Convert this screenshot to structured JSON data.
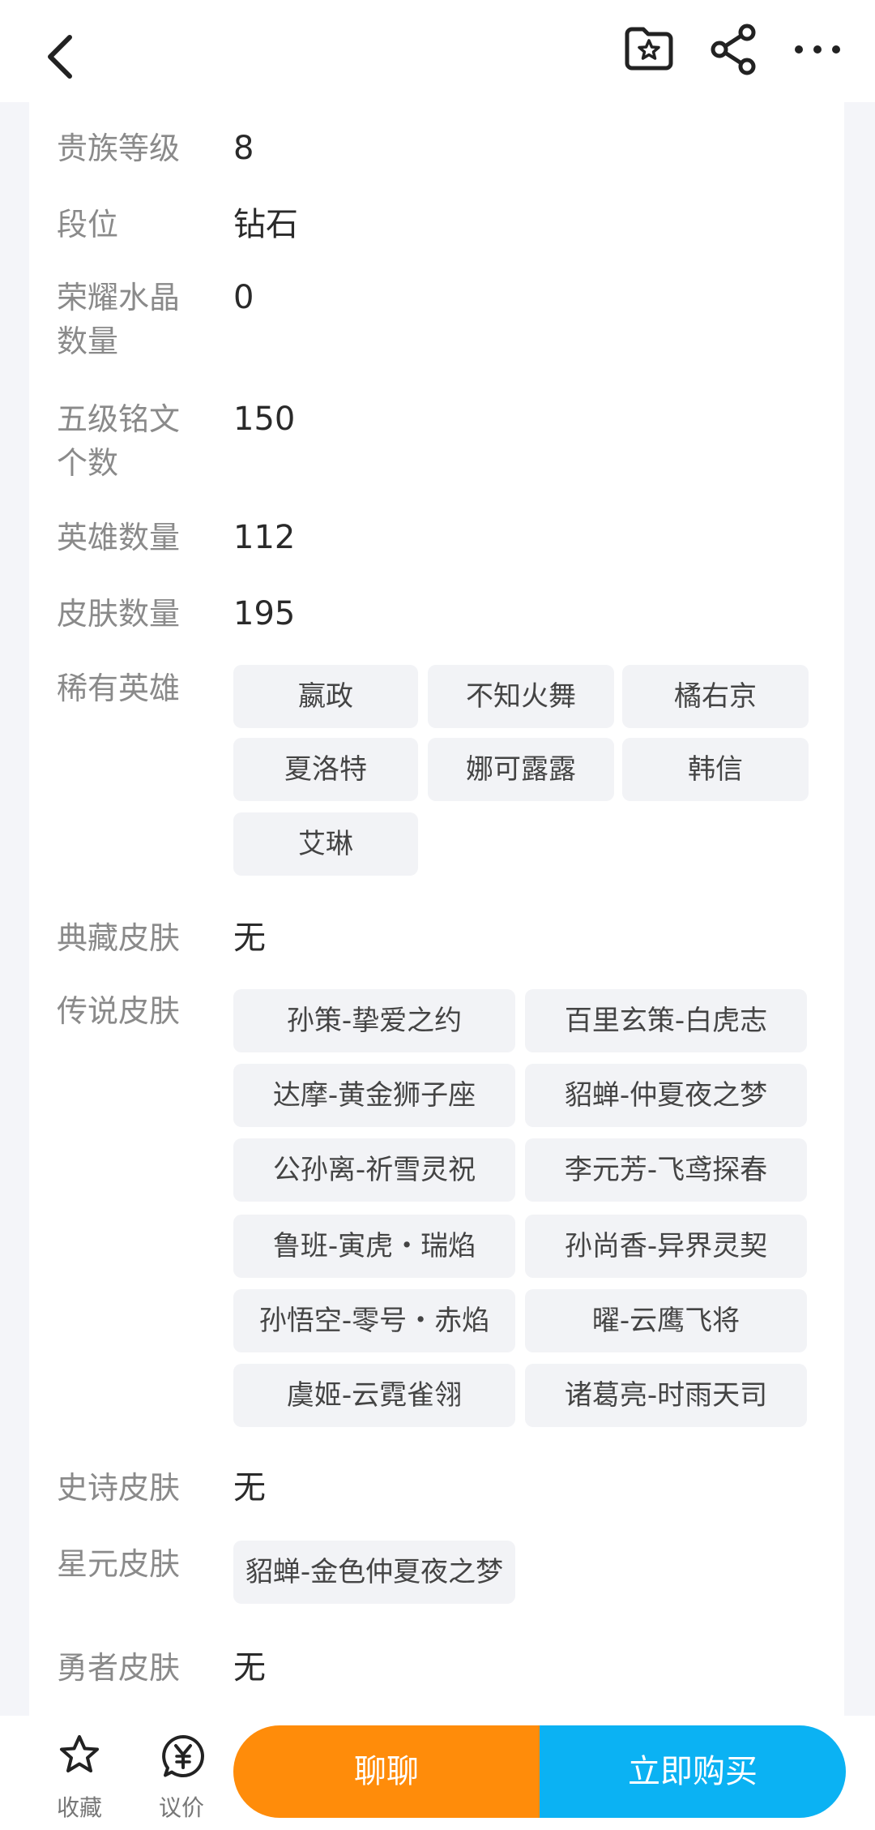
{
  "header": {
    "back_icon": "chevron-left-icon",
    "favorite_icon": "folder-star-icon",
    "share_icon": "share-icon",
    "more_icon": "more-dots-icon"
  },
  "details": {
    "noble_level": {
      "label": "贵族等级",
      "value": "8"
    },
    "rank": {
      "label": "段位",
      "value": "钻石"
    },
    "glory_crystal": {
      "label_line1": "荣耀水晶",
      "label_line2": "数量",
      "value": "0"
    },
    "level5_inscriptions": {
      "label_line1": "五级铭文",
      "label_line2": "个数",
      "value": "150"
    },
    "hero_count": {
      "label": "英雄数量",
      "value": "112"
    },
    "skin_count": {
      "label": "皮肤数量",
      "value": "195"
    },
    "rare_heroes": {
      "label": "稀有英雄",
      "items": [
        "嬴政",
        "不知火舞",
        "橘右京",
        "夏洛特",
        "娜可露露",
        "韩信",
        "艾琳"
      ]
    },
    "collection_skins": {
      "label": "典藏皮肤",
      "value": "无"
    },
    "legend_skins": {
      "label": "传说皮肤",
      "items": [
        "孙策-挚爱之约",
        "百里玄策-白虎志",
        "达摩-黄金狮子座",
        "貂蝉-仲夏夜之梦",
        "公孙离-祈雪灵祝",
        "李元芳-飞鸢探春",
        "鲁班-寅虎・瑞焰",
        "孙尚香-异界灵契",
        "孙悟空-零号・赤焰",
        "曜-云鹰飞将",
        "虞姬-云霓雀翎",
        "诸葛亮-时雨天司"
      ]
    },
    "epic_skins": {
      "label": "史诗皮肤",
      "value": "无"
    },
    "star_skins": {
      "label": "星元皮肤",
      "items": [
        "貂蝉-金色仲夏夜之梦"
      ]
    },
    "brave_skins": {
      "label": "勇者皮肤",
      "value": "无"
    }
  },
  "bottom": {
    "favorite_label": "收藏",
    "favorite_icon": "star-icon",
    "bargain_label": "议价",
    "bargain_icon": "yen-bubble-icon",
    "chat_label": "聊聊",
    "buy_label": "立即购买"
  },
  "colors": {
    "chat_button": "#ff8c0a",
    "buy_button": "#0bb2f3"
  }
}
